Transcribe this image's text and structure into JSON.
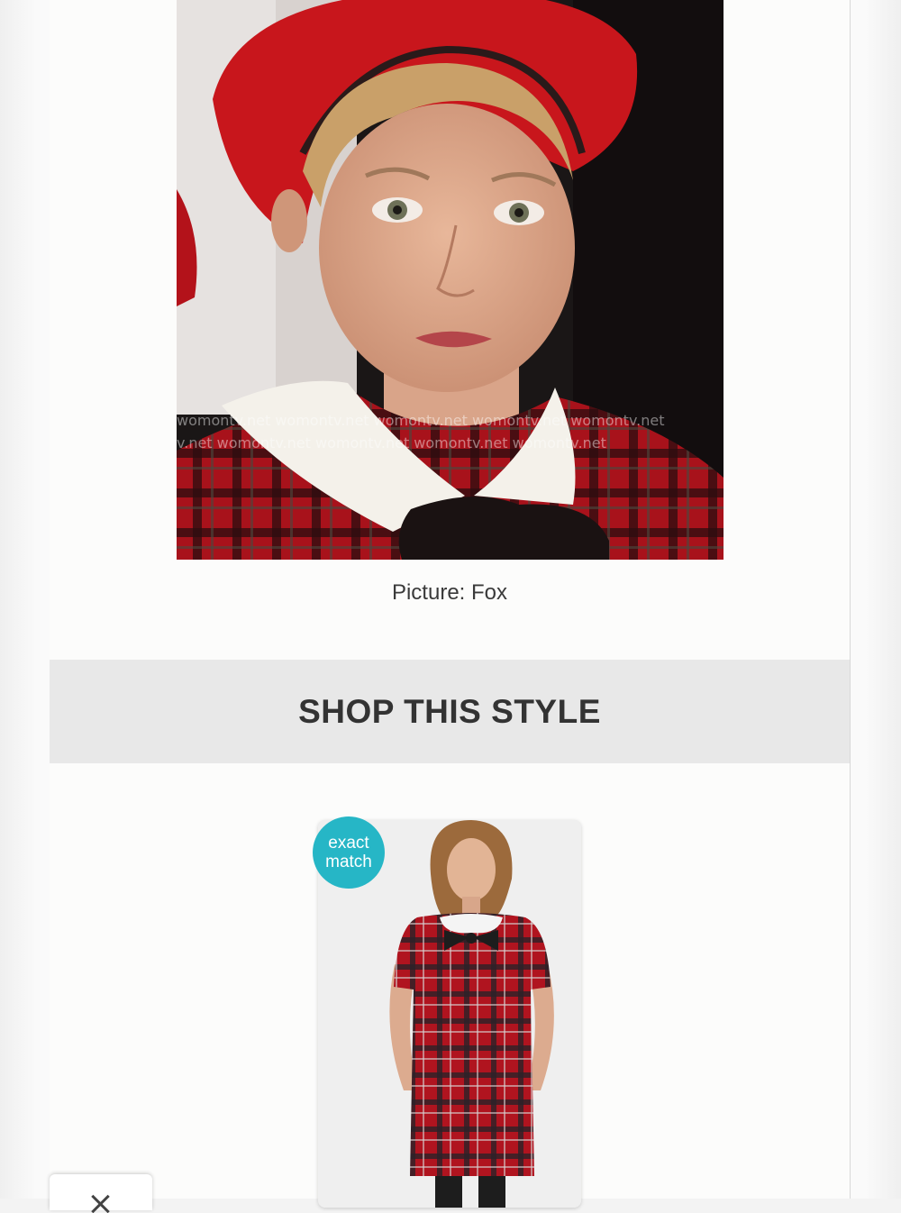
{
  "article": {
    "photo_alt": "Woman in red beret and plaid dress with white collar",
    "caption": "Picture: Fox"
  },
  "watermark": "womontv.net",
  "shop": {
    "title": "SHOP THIS STYLE",
    "product": {
      "badge_line1": "exact",
      "badge_line2": "match",
      "image_alt": "Red plaid dress with white collar and black bow"
    }
  },
  "colors": {
    "badge": "#26b6c6",
    "banner": "#e8e8e8",
    "beret": "#c8161c",
    "plaid": "#b0141f"
  },
  "icons": {
    "close": "close-icon"
  }
}
